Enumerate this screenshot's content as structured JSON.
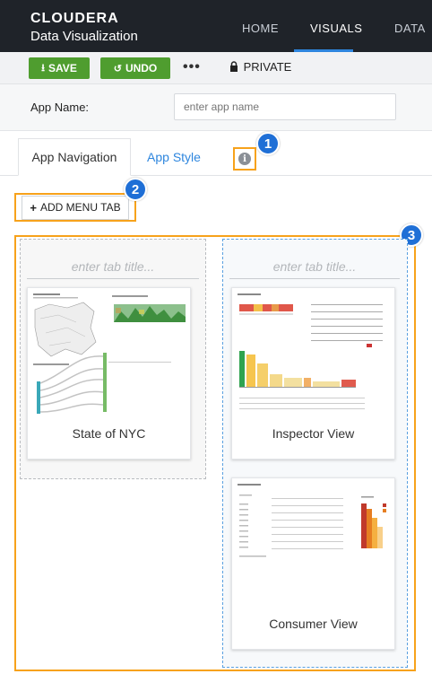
{
  "brand": {
    "name": "CLOUDERA",
    "product": "Data Visualization"
  },
  "nav": {
    "items": [
      "HOME",
      "VISUALS",
      "DATA"
    ],
    "active": "VISUALS"
  },
  "toolbar": {
    "save_label": "SAVE",
    "undo_label": "UNDO",
    "more_label": "•••",
    "private_label": "PRIVATE"
  },
  "app_name": {
    "label": "App Name:",
    "placeholder": "enter app name"
  },
  "tabs": {
    "navigation": "App Navigation",
    "style": "App Style"
  },
  "add_menu_tab_label": "ADD MENU TAB",
  "callouts": [
    "1",
    "2",
    "3"
  ],
  "columns": [
    {
      "title_placeholder": "enter tab title...",
      "cards": [
        "State of NYC"
      ]
    },
    {
      "title_placeholder": "enter tab title...",
      "cards": [
        "Inspector View",
        "Consumer View"
      ]
    }
  ],
  "colors": {
    "accent_blue": "#2e86de",
    "callout_orange": "#f7a21b",
    "save_green": "#4f9d2f",
    "header_dark": "#1f2329"
  }
}
